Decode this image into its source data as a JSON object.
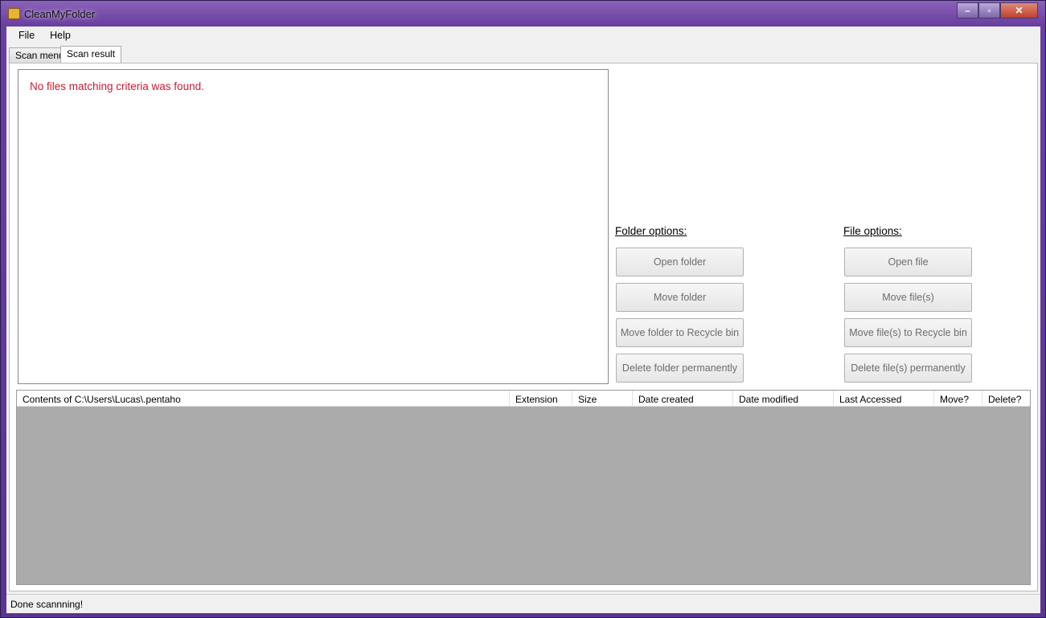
{
  "window": {
    "title": "CleanMyFolder",
    "controls": {
      "minimize": "minimize-icon",
      "maximize": "maximize-icon",
      "close": "close-icon"
    }
  },
  "menu": [
    "File",
    "Help"
  ],
  "tabs": [
    {
      "label": "Scan menu",
      "active": false
    },
    {
      "label": "Scan result",
      "active": true
    }
  ],
  "result": {
    "message": "No files matching criteria was found.",
    "message_color": "#cc1a2e"
  },
  "folder_options": {
    "title": "Folder options:",
    "buttons": [
      "Open folder",
      "Move folder",
      "Move folder to Recycle  bin",
      "Delete folder permanently"
    ]
  },
  "file_options": {
    "title": "File options:",
    "buttons": [
      "Open file",
      "Move file(s)",
      "Move  file(s) to Recycle bin",
      "Delete  file(s) permanently"
    ]
  },
  "grid": {
    "columns": [
      "Contents of C:\\Users\\Lucas\\.pentaho",
      "Extension",
      "Size",
      "Date created",
      "Date modified",
      "Last Accessed",
      "Move?",
      "Delete?"
    ],
    "rows": []
  },
  "status": "Done scannning!"
}
